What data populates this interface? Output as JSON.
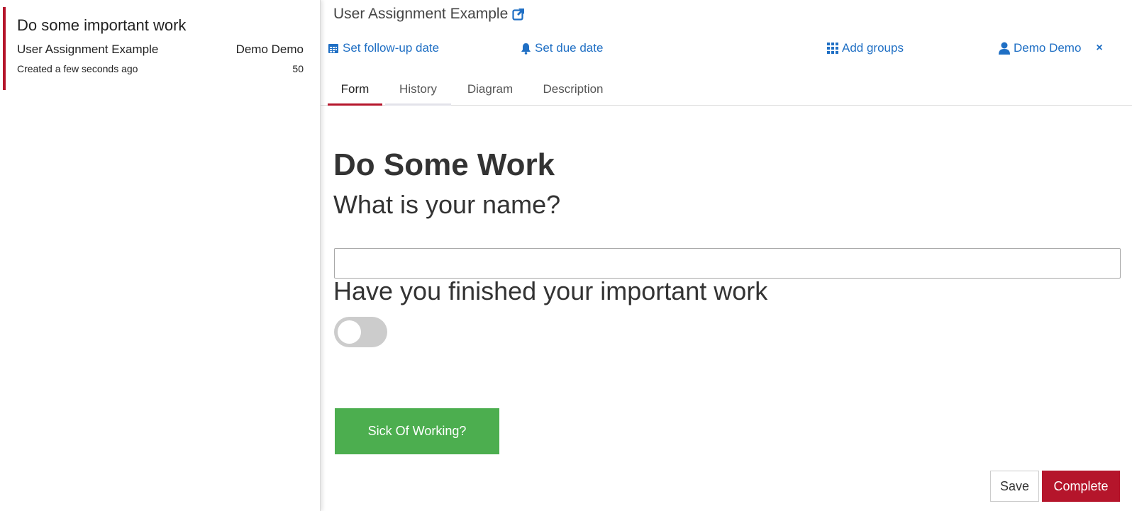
{
  "task_list": {
    "items": [
      {
        "name": "Do some important work",
        "process": "User Assignment Example",
        "assignee": "Demo Demo",
        "created": "Created a few seconds ago",
        "priority": "50"
      }
    ]
  },
  "task_detail": {
    "process_name": "User Assignment Example",
    "actions": {
      "follow_up": "Set follow-up date",
      "due_date": "Set due date",
      "groups": "Add groups",
      "assignee": "Demo Demo",
      "remove": "×"
    },
    "tabs": [
      {
        "label": "Form",
        "active": true
      },
      {
        "label": "History",
        "active": false
      },
      {
        "label": "Diagram",
        "active": false
      },
      {
        "label": "Description",
        "active": false
      }
    ]
  },
  "form": {
    "title": "Do Some Work",
    "question_name": "What is your name?",
    "name_value": "",
    "question_finished": "Have you finished your important work",
    "finished_checked": false,
    "sick_button": "Sick Of Working?"
  },
  "footer": {
    "save": "Save",
    "complete": "Complete"
  },
  "colors": {
    "accent": "#b5152b",
    "link": "#1f6fc4",
    "success": "#4cae4f",
    "toggle_off": "#cccccc"
  },
  "icons": {
    "external_link": "external-link-icon",
    "calendar": "calendar-icon",
    "bell": "bell-icon",
    "grid": "grid-icon",
    "user": "user-icon",
    "close": "close-icon"
  }
}
